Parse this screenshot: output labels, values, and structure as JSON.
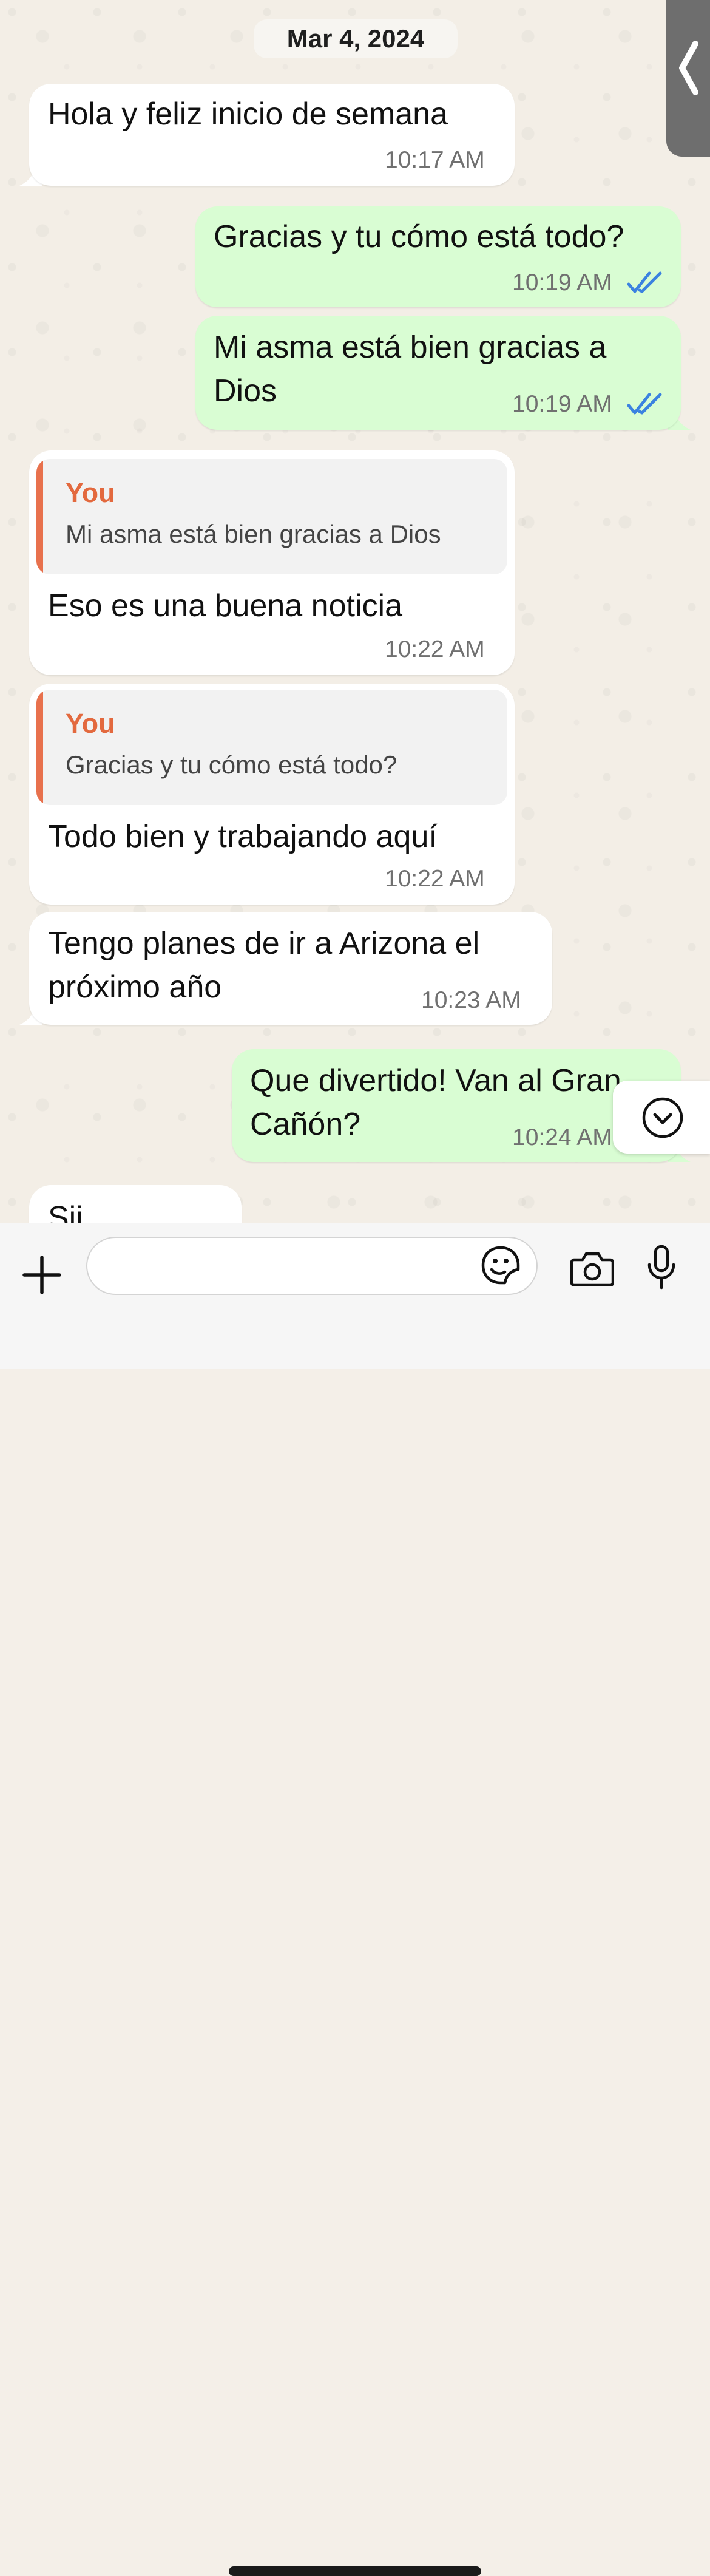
{
  "chat": {
    "date_label": "Mar 4, 2024",
    "messages": [
      {
        "direction": "in",
        "text_lines": [
          "Hola y feliz inicio de semana"
        ],
        "time": "10:17 AM"
      },
      {
        "direction": "out",
        "text_lines": [
          "Gracias y tu cómo está todo?"
        ],
        "time": "10:19 AM",
        "status": "read"
      },
      {
        "direction": "out",
        "text_lines": [
          "Mi asma está bien gracias a",
          "Dios"
        ],
        "time": "10:19 AM",
        "status": "read"
      },
      {
        "direction": "in",
        "quote": {
          "author": "You",
          "text": "Mi asma está bien gracias a Dios"
        },
        "text_lines": [
          "Eso es una buena noticia"
        ],
        "time": "10:22 AM"
      },
      {
        "direction": "in",
        "quote": {
          "author": "You",
          "text": "Gracias y tu cómo está todo?"
        },
        "text_lines": [
          "Todo bien y trabajando aquí"
        ],
        "time": "10:22 AM"
      },
      {
        "direction": "in",
        "text_lines": [
          "Tengo planes de ir a Arizona el",
          "próximo año"
        ],
        "time": "10:23 AM"
      },
      {
        "direction": "out",
        "text_lines": [
          "Que divertido! Van al Gran",
          "Cañón?"
        ],
        "time": "10:24 AM"
      },
      {
        "direction": "in",
        "text_lines": [
          "Sii"
        ],
        "time": ""
      }
    ]
  },
  "colors": {
    "incoming_bubble": "#ffffff",
    "outgoing_bubble": "#d9fdd3",
    "quote_accent": "#e3693e",
    "read_ticks": "#3b82e0",
    "chat_background": "#f3eee6"
  },
  "icons": {
    "side_tab": "chevron-left-icon",
    "scroll_down": "chevron-down-circle-icon",
    "attach": "plus-icon",
    "sticker": "sticker-icon",
    "camera": "camera-icon",
    "mic": "microphone-icon",
    "read_status": "double-check-icon"
  }
}
